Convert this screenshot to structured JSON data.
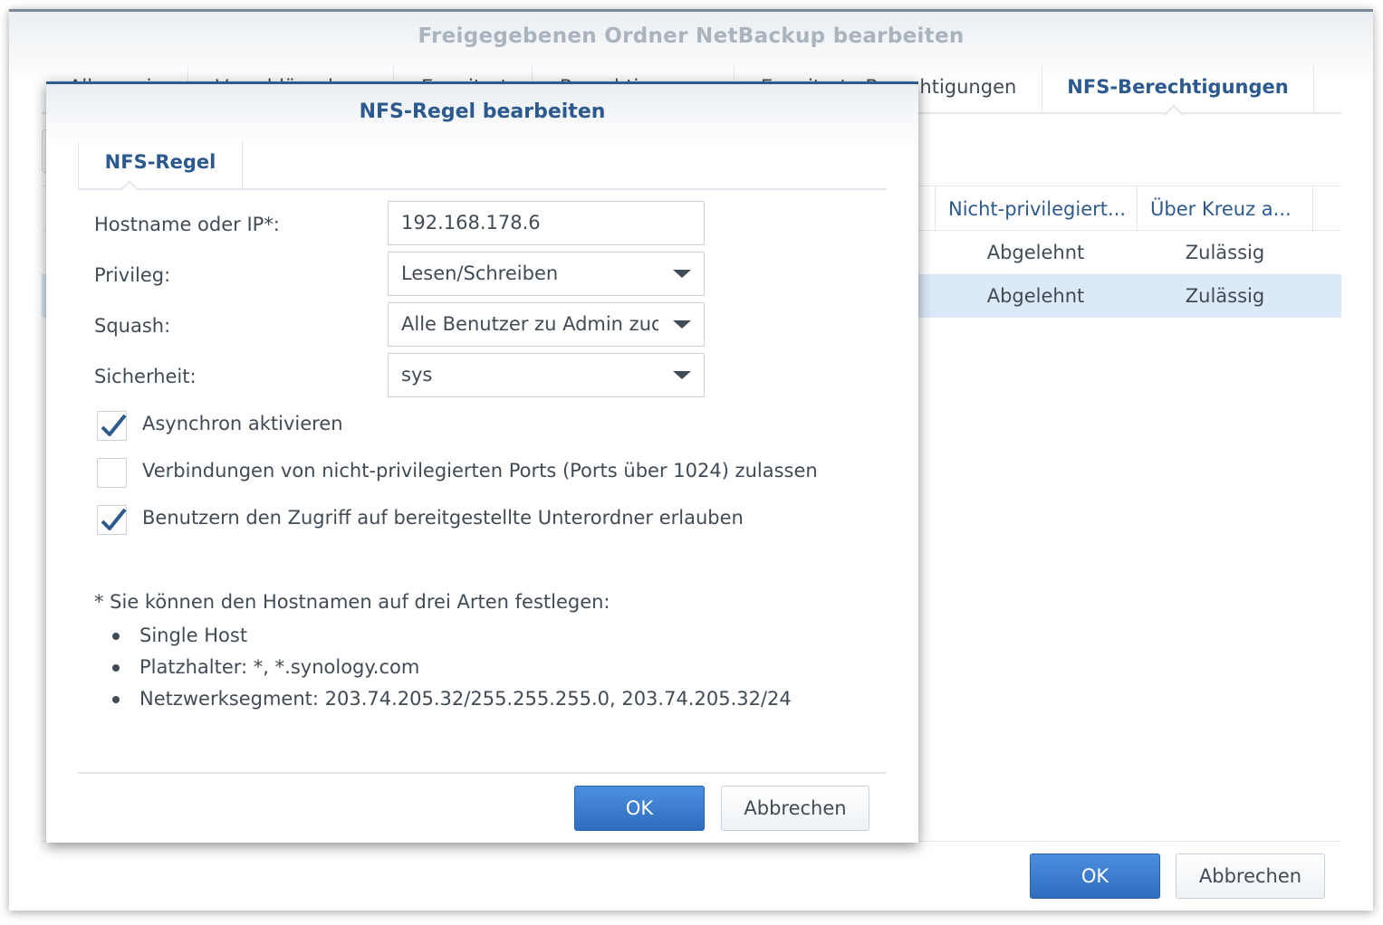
{
  "outer_window": {
    "title": "Freigegebenen Ordner NetBackup bearbeiten",
    "tabs": [
      {
        "label": "Allgemein"
      },
      {
        "label": "Verschlüsselung"
      },
      {
        "label": "Erweitert"
      },
      {
        "label": "Berechtigungen"
      },
      {
        "label": "Erweiterte Berechtigungen"
      },
      {
        "label": "NFS-Berechtigungen"
      }
    ],
    "grid": {
      "columns": [
        "Nicht-privilegiert...",
        "Über Kreuz a..."
      ],
      "rows": [
        {
          "non_privileged": "Abgelehnt",
          "cross_mount": "Zulässig"
        },
        {
          "non_privileged": "Abgelehnt",
          "cross_mount": "Zulässig"
        }
      ]
    },
    "ok_label": "OK",
    "cancel_label": "Abbrechen"
  },
  "modal": {
    "title": "NFS-Regel bearbeiten",
    "tab": "NFS-Regel",
    "fields": {
      "hostname_label": "Hostname oder IP*:",
      "hostname_value": "192.168.178.6",
      "privilege_label": "Privileg:",
      "privilege_value": "Lesen/Schreiben",
      "squash_label": "Squash:",
      "squash_value": "Alle Benutzer zu Admin zuordnen",
      "security_label": "Sicherheit:",
      "security_value": "sys"
    },
    "checkboxes": [
      {
        "label": "Asynchron aktivieren",
        "checked": true
      },
      {
        "label": "Verbindungen von nicht-privilegierten Ports (Ports über 1024) zulassen",
        "checked": false
      },
      {
        "label": "Benutzern den Zugriff auf bereitgestellte Unterordner erlauben",
        "checked": true
      }
    ],
    "hint": {
      "intro": "* Sie können den Hostnamen auf drei Arten festlegen:",
      "items": [
        "Single Host",
        "Platzhalter: *, *.synology.com",
        "Netzwerksegment: 203.74.205.32/255.255.255.0, 203.74.205.32/24"
      ]
    },
    "ok_label": "OK",
    "cancel_label": "Abbrechen"
  },
  "colors": {
    "accent": "#2d5a8e",
    "primary_button": "#3a7bd0",
    "selected_row": "#dbe9f9",
    "check": "#2d5a8e"
  }
}
